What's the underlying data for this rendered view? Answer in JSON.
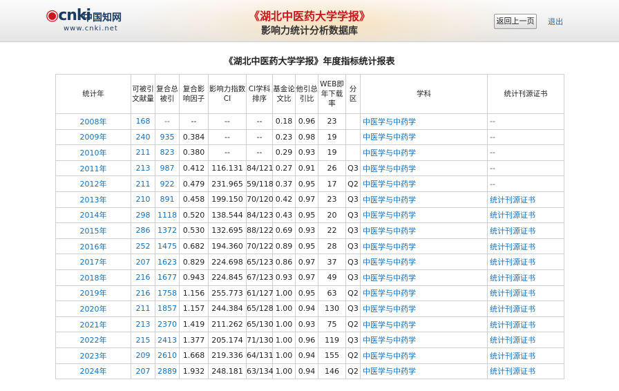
{
  "header": {
    "logo_text": "cnki",
    "logo_cn": "中国知网",
    "logo_url": "www.cnki.net",
    "title": "《湖北中医药大学学报》",
    "subtitle": "影响力统计分析数据库",
    "back_label": "返回上一页",
    "logout_label": "退出"
  },
  "report": {
    "title": "《湖北中医药大学学报》年度指标统计报表",
    "headers": [
      "统计年",
      "可被引文献量",
      "复合总被引",
      "复合影响因子",
      "影响力指数CI",
      "CI学科排序",
      "基金论文比",
      "他引总引比",
      "WEB即年下载率",
      "分区",
      "学科",
      "统计刊源证书"
    ],
    "rows": [
      [
        "2008年",
        "168",
        "--",
        "--",
        "--",
        "--",
        "0.18",
        "0.96",
        "23",
        "",
        "中医学与中药学",
        "--"
      ],
      [
        "2009年",
        "240",
        "935",
        "0.384",
        "--",
        "--",
        "0.23",
        "0.98",
        "19",
        "",
        "中医学与中药学",
        "--"
      ],
      [
        "2010年",
        "211",
        "823",
        "0.380",
        "--",
        "--",
        "0.29",
        "0.93",
        "19",
        "",
        "中医学与中药学",
        "--"
      ],
      [
        "2011年",
        "213",
        "987",
        "0.412",
        "116.131",
        "84/121",
        "0.27",
        "0.91",
        "26",
        "Q3",
        "中医学与中药学",
        "--"
      ],
      [
        "2012年",
        "211",
        "922",
        "0.479",
        "231.965",
        "59/118",
        "0.37",
        "0.95",
        "17",
        "Q2",
        "中医学与中药学",
        "--"
      ],
      [
        "2013年",
        "210",
        "891",
        "0.458",
        "199.150",
        "70/120",
        "0.42",
        "0.97",
        "23",
        "Q3",
        "中医学与中药学",
        "统计刊源证书"
      ],
      [
        "2014年",
        "298",
        "1118",
        "0.520",
        "138.544",
        "84/123",
        "0.43",
        "0.95",
        "20",
        "Q3",
        "中医学与中药学",
        "统计刊源证书"
      ],
      [
        "2015年",
        "286",
        "1372",
        "0.530",
        "132.695",
        "88/122",
        "0.69",
        "0.93",
        "22",
        "Q3",
        "中医学与中药学",
        "统计刊源证书"
      ],
      [
        "2016年",
        "252",
        "1475",
        "0.682",
        "194.360",
        "70/122",
        "0.89",
        "0.95",
        "28",
        "Q3",
        "中医学与中药学",
        "统计刊源证书"
      ],
      [
        "2017年",
        "207",
        "1623",
        "0.829",
        "224.698",
        "65/123",
        "0.86",
        "0.97",
        "37",
        "Q3",
        "中医学与中药学",
        "统计刊源证书"
      ],
      [
        "2018年",
        "216",
        "1677",
        "0.943",
        "224.845",
        "67/123",
        "0.93",
        "0.97",
        "49",
        "Q3",
        "中医学与中药学",
        "统计刊源证书"
      ],
      [
        "2019年",
        "216",
        "1758",
        "1.156",
        "255.773",
        "61/127",
        "1.00",
        "0.95",
        "63",
        "Q2",
        "中医学与中药学",
        "统计刊源证书"
      ],
      [
        "2020年",
        "211",
        "1857",
        "1.157",
        "244.384",
        "65/128",
        "1.00",
        "0.94",
        "130",
        "Q3",
        "中医学与中药学",
        "统计刊源证书"
      ],
      [
        "2021年",
        "213",
        "2370",
        "1.419",
        "211.262",
        "65/130",
        "1.00",
        "0.93",
        "75",
        "Q2",
        "中医学与中药学",
        "统计刊源证书"
      ],
      [
        "2022年",
        "215",
        "2413",
        "1.377",
        "205.174",
        "71/130",
        "1.00",
        "0.96",
        "119",
        "Q3",
        "中医学与中药学",
        "统计刊源证书"
      ],
      [
        "2023年",
        "209",
        "2610",
        "1.668",
        "219.336",
        "64/131",
        "1.00",
        "0.94",
        "155",
        "Q2",
        "中医学与中药学",
        "统计刊源证书"
      ],
      [
        "2024年",
        "207",
        "2889",
        "1.932",
        "248.181",
        "63/134",
        "1.00",
        "0.94",
        "146",
        "Q2",
        "中医学与中药学",
        "统计刊源证书"
      ]
    ]
  },
  "colors": {
    "link": "#1a70b8",
    "brand_red": "#c8181e",
    "border": "#cfcfcf"
  }
}
